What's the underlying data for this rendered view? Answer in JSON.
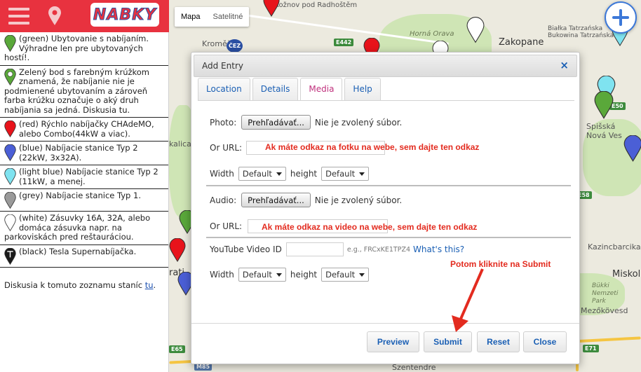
{
  "map": {
    "type_buttons": [
      "Mapa",
      "Satelitné"
    ],
    "labels": [
      "Rožnov pod Radhoštěm",
      "Kroměříž",
      "Horná Orava",
      "Zakopane",
      "Białka Tatrzańska",
      "Bukowina Tatrzańska",
      "Spišská Nová Ves",
      "Kazincbarcika",
      "Miskol",
      "Bükki Nemzeti Park",
      "Mezőkövesd",
      "Szentendre",
      "kalica",
      "rati"
    ],
    "shields": [
      "E442",
      "E50",
      "E58",
      "E65",
      "E71",
      "M85",
      "ČEZ"
    ]
  },
  "sidebar": {
    "logo_text": "NABKY",
    "legend": [
      {
        "color": "#5aa83a",
        "ring": "",
        "text": "(green) Ubytovanie s nabíjaním. Výhradne len pre ubytovaných hostí!.",
        "sub": ""
      },
      {
        "color": "#5aa83a",
        "ring": "#ffffff",
        "text": "Zelený bod s farebným krúžkom znamená, že nabíjanie nie je podmienené ubytovaním a zároveň farba krúžku označuje o aký druh nabíjania sa jedná. Diskusia tu.",
        "sub": ""
      },
      {
        "color": "#e8131b",
        "ring": "",
        "text": "(red) Rýchlo nabíjačky CHAdeMO, alebo Combo(44kW a viac).",
        "sub": ""
      },
      {
        "color": "#4b5fd6",
        "ring": "",
        "text": "(blue) Nabíjacie stanice Typ 2 (22kW, 3x32A).",
        "sub": ""
      },
      {
        "color": "#7fe3f0",
        "ring": "",
        "text": "(light blue) Nabíjacie stanice Typ 2 (11kW, a menej.",
        "sub": ""
      },
      {
        "color": "#9a9a9a",
        "ring": "",
        "text": "(grey) Nabíjacie stanice Typ 1.",
        "sub": ""
      },
      {
        "color": "#ffffff",
        "ring": "",
        "text": "(white) Zásuvky 16A, 32A, alebo domáca zásuvka napr. na parkoviskách pred reštauráciou.",
        "sub": ""
      },
      {
        "color": "#1a1a1a",
        "ring": "",
        "text": "(black) Tesla Supernabíjačka.",
        "sub": ""
      }
    ],
    "discussion_text": "Diskusia k tomuto zoznamu staníc ",
    "discussion_link": "tu",
    "discussion_end": "."
  },
  "modal": {
    "title": "Add Entry",
    "close": "×",
    "tabs": [
      "Location",
      "Details",
      "Media",
      "Help"
    ],
    "active_tab": "Media",
    "photo_label": "Photo:",
    "browse_label": "Prehľadávať...",
    "no_file": "Nie je zvolený súbor.",
    "or_url": "Or URL:",
    "photo_hint": "Ak máte odkaz na fotku na webe, sem dajte ten odkaz",
    "width_label": "Width",
    "height_label": "height",
    "default_option": "Default",
    "audio_label": "Audio:",
    "video_hint": "Ak máte odkaz na video na webe, sem dajte ten odkaz",
    "youtube_label": "YouTube Video ID",
    "youtube_example": "e.g., FRCxKE1TPZ4",
    "whats_this": "What's this?",
    "buttons": {
      "preview": "Preview",
      "submit": "Submit",
      "reset": "Reset",
      "close": "Close"
    }
  },
  "annotation": {
    "submit_hint": "Potom kliknite na Submit"
  },
  "colors": {
    "header_red": "#e8323f",
    "link_blue": "#1a5fb4",
    "hint_red": "#e32b1f",
    "active_tab": "#c0317d"
  }
}
